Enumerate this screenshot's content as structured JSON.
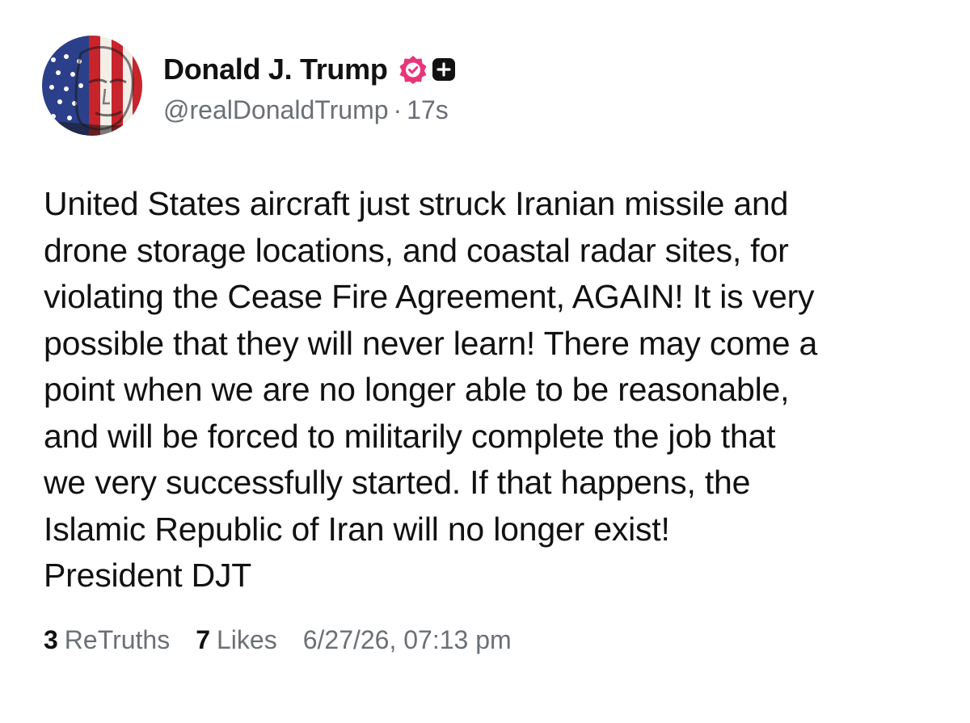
{
  "author": {
    "display_name": "Donald J. Trump",
    "handle": "@realDonaldTrump",
    "separator": "·",
    "time_ago": "17s",
    "avatar_icon": "avatar-flag-portrait",
    "verified_icon": "verified-badge-icon",
    "plus_icon": "plus-square-icon",
    "verified_color": "#e8357a"
  },
  "post": {
    "text": "United States aircraft just struck Iranian missile and\ndrone storage locations, and coastal radar sites, for\nviolating the Cease Fire Agreement, AGAIN! It is very\npossible that they will never learn! There may come a\npoint when we are no longer able to be reasonable,\nand will be forced to militarily complete the job that\nwe very successfully started. If that happens, the\nIslamic Republic of Iran will no longer exist!\nPresident DJT"
  },
  "stats": {
    "retruths_count": "3",
    "retruths_label": "ReTruths",
    "likes_count": "7",
    "likes_label": "Likes",
    "timestamp": "6/27/26, 07:13 pm"
  }
}
